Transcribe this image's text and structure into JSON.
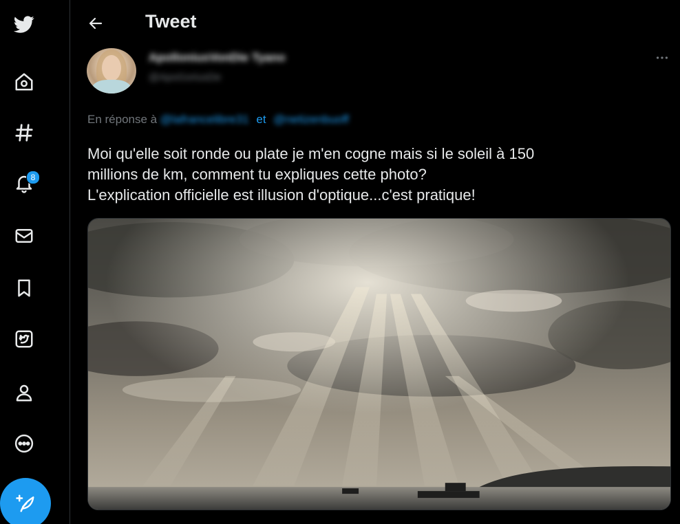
{
  "sidebar": {
    "items": [
      {
        "name": "twitter-logo-icon"
      },
      {
        "name": "home-icon"
      },
      {
        "name": "explore-hashtag-icon"
      },
      {
        "name": "notifications-bell-icon",
        "badge": "8"
      },
      {
        "name": "messages-envelope-icon"
      },
      {
        "name": "bookmarks-icon"
      },
      {
        "name": "twitter-blue-icon"
      },
      {
        "name": "profile-person-icon"
      },
      {
        "name": "more-circle-icon"
      }
    ],
    "compose_icon": "feather-plus-icon"
  },
  "header": {
    "title": "Tweet",
    "back_icon": "arrow-left-icon"
  },
  "tweet": {
    "author": {
      "display_name": "ApolloniusVonDie Tyano",
      "handle": "@ApoGoriusDe"
    },
    "reply_to": {
      "prefix": "En réponse à",
      "mention_1": "@lafrancelibre31",
      "connector": "et",
      "mention_2": "@netizenbuoff"
    },
    "text_lines": [
      "Moi qu'elle soit ronde ou plate je m'en cogne mais si le soleil à 150",
      "millions de km, comment tu expliques cette photo?",
      "L'explication officielle est illusion d'optique...c'est pratique!"
    ],
    "more_icon": "more-horizontal-icon",
    "media": {
      "type": "photo",
      "description_icon": "sunbeams-through-clouds-photo"
    }
  },
  "colors": {
    "background": "#000000",
    "accent": "#1d9bf0",
    "text_primary": "#e7e9ea",
    "text_secondary": "#71767b",
    "divider": "#2f3336"
  }
}
